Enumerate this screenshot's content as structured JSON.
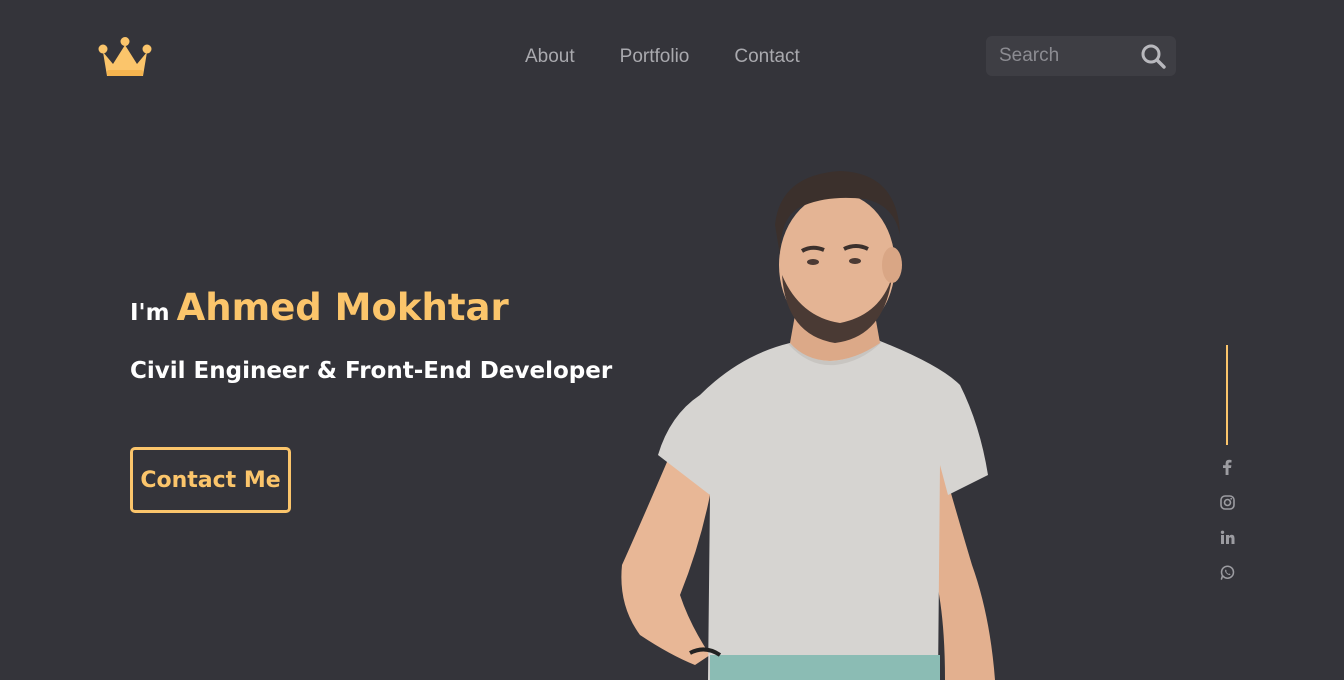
{
  "nav": {
    "items": [
      {
        "label": "About"
      },
      {
        "label": "Portfolio"
      },
      {
        "label": "Contact"
      }
    ]
  },
  "search": {
    "placeholder": "Search",
    "icon": "search-icon"
  },
  "hero": {
    "intro": "I'm",
    "name": "Ahmed Mokhtar",
    "role": "Civil Engineer & Front-End Developer",
    "cta_label": "Contact Me"
  },
  "social": {
    "icons": [
      "facebook-icon",
      "instagram-icon",
      "linkedin-icon",
      "whatsapp-icon"
    ]
  },
  "colors": {
    "background": "#34343a",
    "accent": "#fbc56b",
    "nav_text": "#a9a9ae",
    "search_bg": "#3e3e44"
  }
}
